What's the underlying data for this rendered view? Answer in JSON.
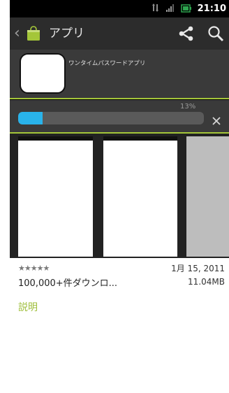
{
  "statusbar": {
    "time": "21:10"
  },
  "actionbar": {
    "title": "アプリ"
  },
  "app": {
    "name": "ワンタイムパスワードアプリ"
  },
  "download": {
    "percent_label": "13%",
    "progress": 0.13
  },
  "details": {
    "rating_stars": "★★★★★",
    "date": "1月 15, 2011",
    "downloads": "100,000+件ダウンロ...",
    "size": "11.04MB",
    "description_heading": "説明"
  },
  "colors": {
    "accent_green": "#a4c639",
    "progress_blue": "#29b3ea"
  },
  "icons": [
    "up-chevron-icon",
    "market-bag-icon",
    "share-icon",
    "search-icon",
    "close-icon",
    "signal-icon",
    "battery-icon"
  ]
}
